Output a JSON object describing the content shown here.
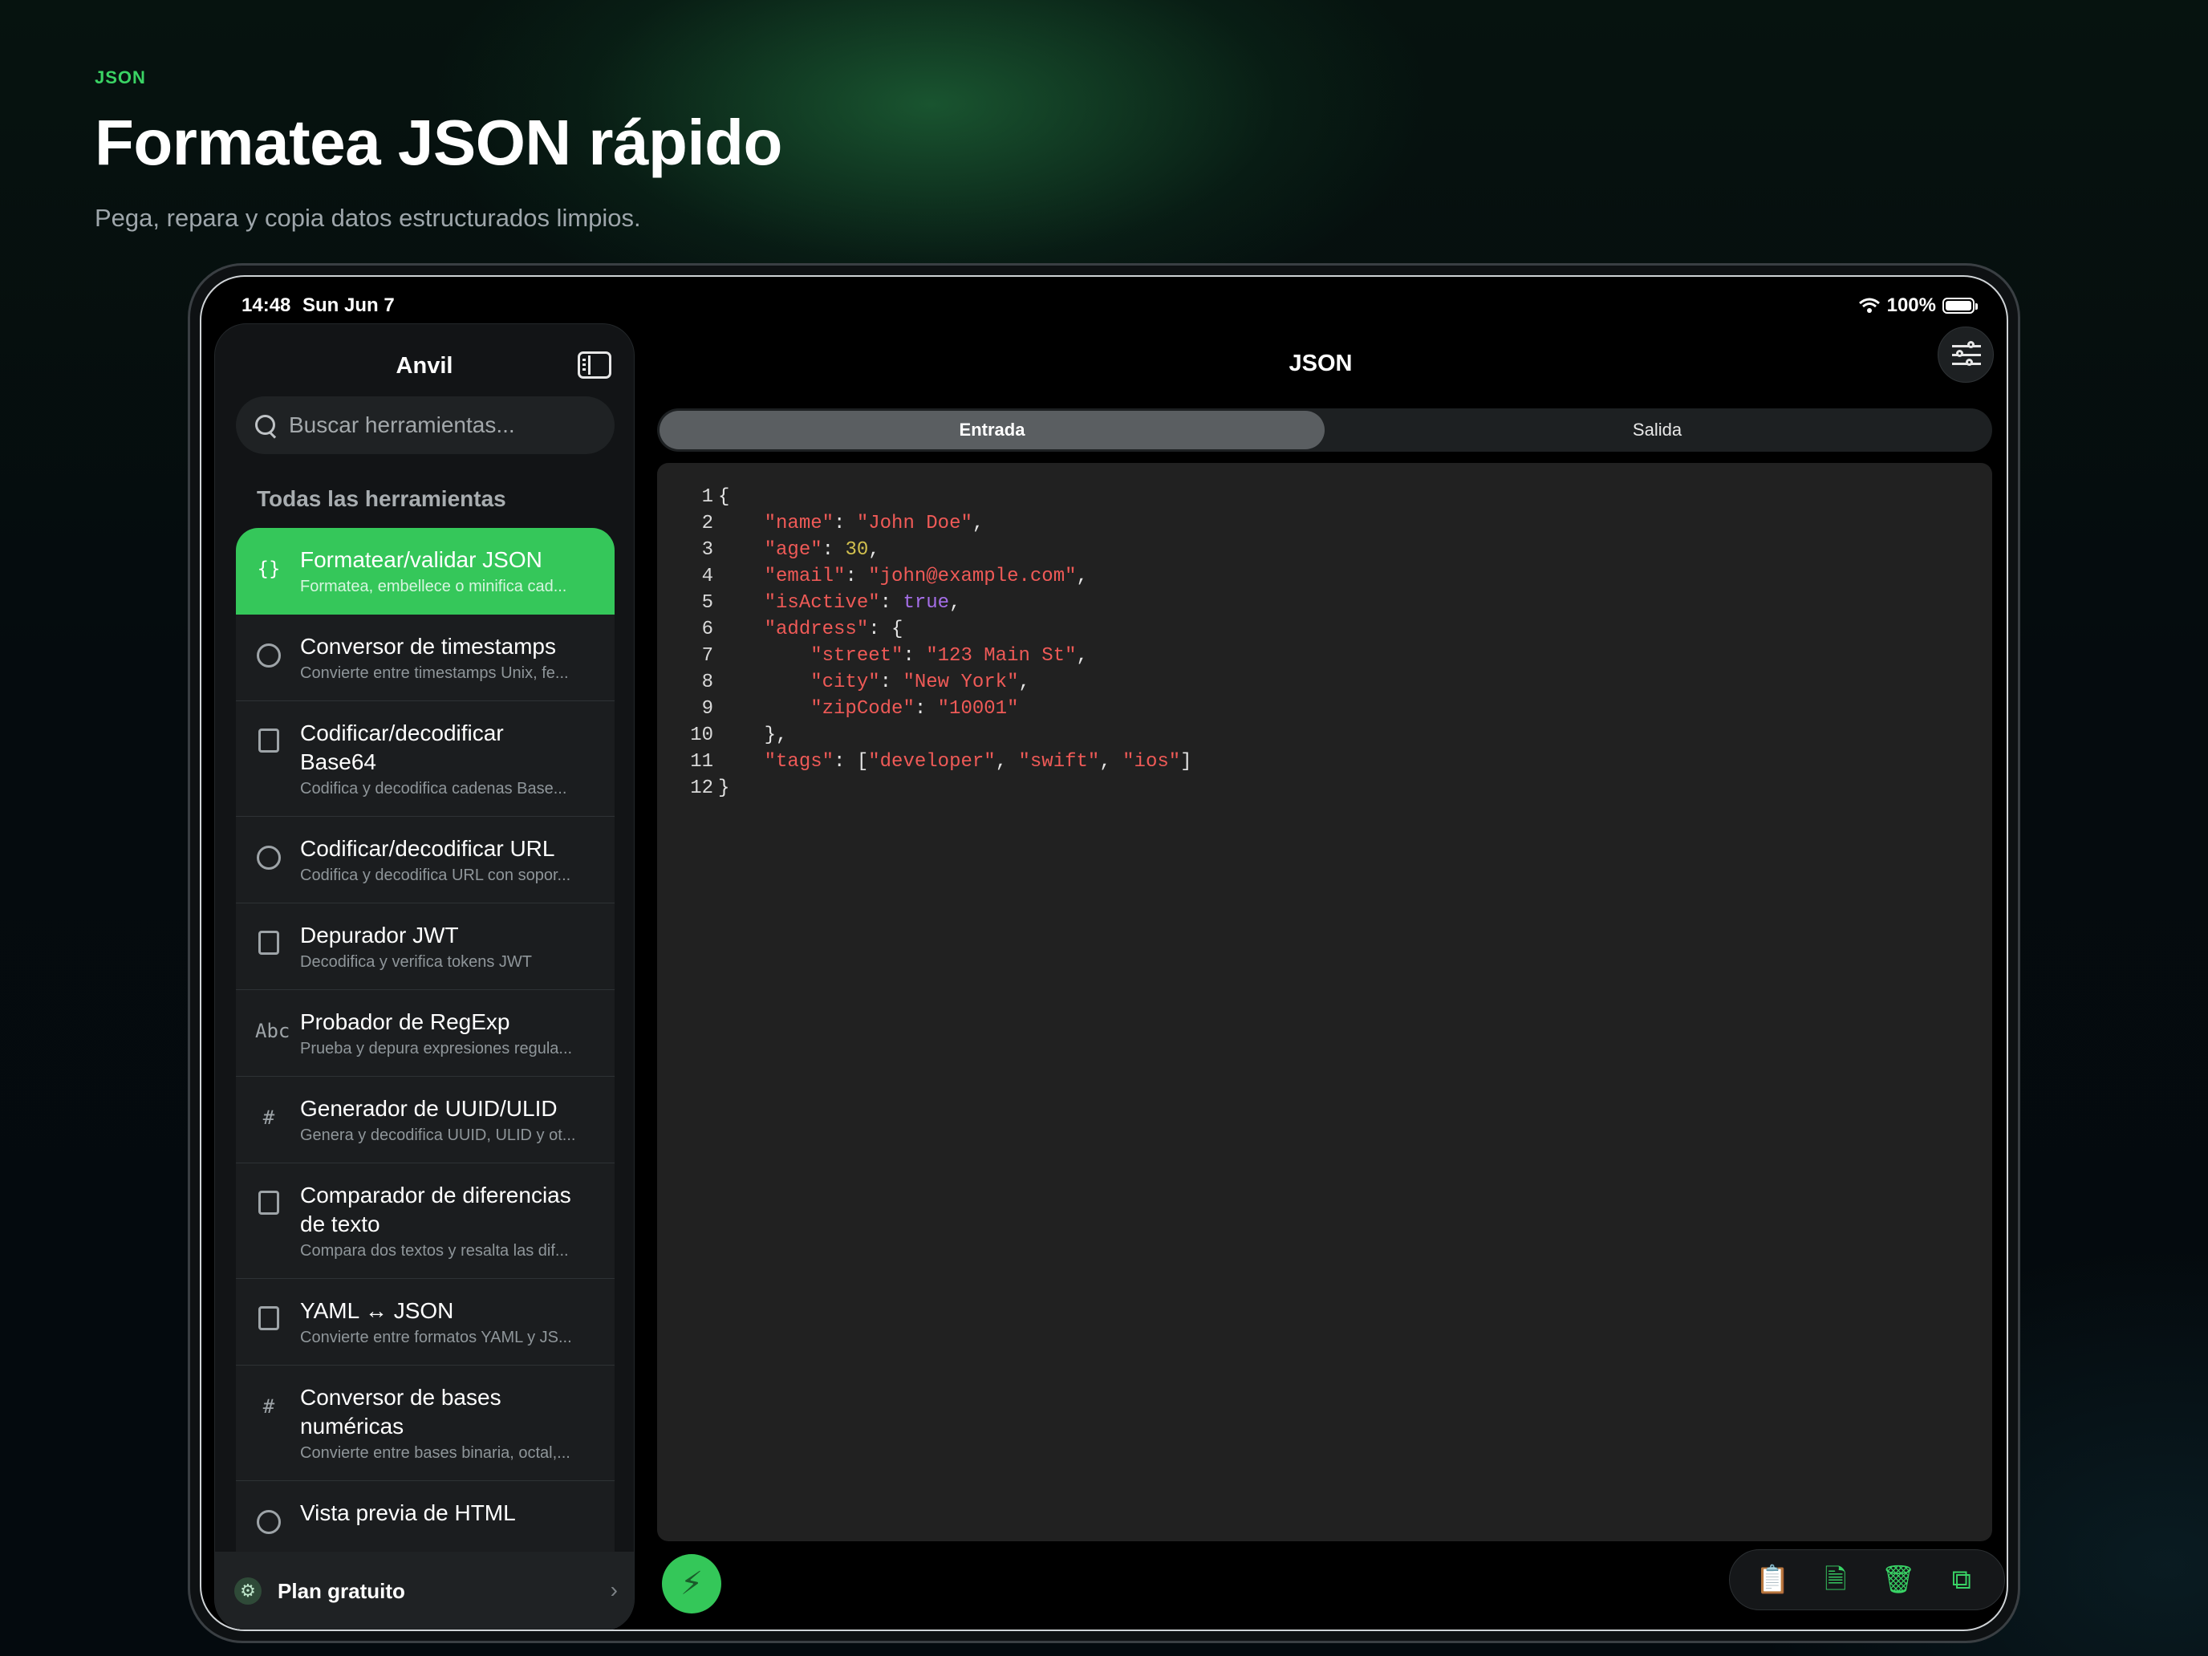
{
  "hero": {
    "eyebrow": "JSON",
    "title": "Formatea JSON rápido",
    "subtitle": "Pega, repara y copia datos estructurados limpios."
  },
  "status_bar": {
    "time": "14:48",
    "date": "Sun Jun 7",
    "battery": "100%"
  },
  "sidebar": {
    "title": "Anvil",
    "search_placeholder": "Buscar herramientas...",
    "section_label": "Todas las herramientas",
    "tools": [
      {
        "name": "Formatear/validar JSON",
        "desc": "Formatea, embellece o minifica cad...",
        "icon": "braces-icon",
        "active": true
      },
      {
        "name": "Conversor de timestamps",
        "desc": "Convierte entre timestamps Unix, fe...",
        "icon": "clock-icon"
      },
      {
        "name": "Codificar/decodificar Base64",
        "desc": "Codifica y decodifica cadenas Base...",
        "icon": "document-search-icon"
      },
      {
        "name": "Codificar/decodificar URL",
        "desc": "Codifica y decodifica URL con sopor...",
        "icon": "link-icon"
      },
      {
        "name": "Depurador JWT",
        "desc": "Decodifica y verifica tokens JWT",
        "icon": "key-frame-icon"
      },
      {
        "name": "Probador de RegExp",
        "desc": "Prueba y depura expresiones regula...",
        "icon": "abc-text-icon",
        "icon_text": "Abc"
      },
      {
        "name": "Generador de UUID/ULID",
        "desc": "Genera y decodifica UUID, ULID y ot...",
        "icon": "hash-icon",
        "icon_text": "#"
      },
      {
        "name": "Comparador de diferencias de texto",
        "desc": "Compara dos textos y resalta las dif...",
        "icon": "diff-document-icon"
      },
      {
        "name": "YAML ↔ JSON",
        "desc": "Convierte entre formatos YAML y JS...",
        "icon": "swap-icon"
      },
      {
        "name": "Conversor de bases numéricas",
        "desc": "Convierte entre bases binaria, octal,...",
        "icon": "number-hash-icon",
        "icon_text": "#"
      },
      {
        "name": "Vista previa de HTML",
        "desc": "",
        "icon": "compass-icon"
      }
    ],
    "plan_label": "Plan gratuito"
  },
  "main": {
    "title": "JSON",
    "tabs": [
      {
        "label": "Entrada",
        "active": true
      },
      {
        "label": "Salida",
        "active": false
      }
    ],
    "line_numbers": [
      "1",
      "2",
      "3",
      "4",
      "5",
      "6",
      "7",
      "8",
      "9",
      "10",
      "11",
      "12"
    ],
    "code_lines": [
      [
        {
          "t": "{",
          "c": "p"
        }
      ],
      [
        {
          "t": "    ",
          "c": "p"
        },
        {
          "t": "\"name\"",
          "c": "k"
        },
        {
          "t": ": ",
          "c": "p"
        },
        {
          "t": "\"John Doe\"",
          "c": "s"
        },
        {
          "t": ",",
          "c": "p"
        }
      ],
      [
        {
          "t": "    ",
          "c": "p"
        },
        {
          "t": "\"age\"",
          "c": "k"
        },
        {
          "t": ": ",
          "c": "p"
        },
        {
          "t": "30",
          "c": "n"
        },
        {
          "t": ",",
          "c": "p"
        }
      ],
      [
        {
          "t": "    ",
          "c": "p"
        },
        {
          "t": "\"email\"",
          "c": "k"
        },
        {
          "t": ": ",
          "c": "p"
        },
        {
          "t": "\"john@example.com\"",
          "c": "s"
        },
        {
          "t": ",",
          "c": "p"
        }
      ],
      [
        {
          "t": "    ",
          "c": "p"
        },
        {
          "t": "\"isActive\"",
          "c": "k"
        },
        {
          "t": ": ",
          "c": "p"
        },
        {
          "t": "true",
          "c": "b"
        },
        {
          "t": ",",
          "c": "p"
        }
      ],
      [
        {
          "t": "    ",
          "c": "p"
        },
        {
          "t": "\"address\"",
          "c": "k"
        },
        {
          "t": ": {",
          "c": "p"
        }
      ],
      [
        {
          "t": "        ",
          "c": "p"
        },
        {
          "t": "\"street\"",
          "c": "k"
        },
        {
          "t": ": ",
          "c": "p"
        },
        {
          "t": "\"123 Main St\"",
          "c": "s"
        },
        {
          "t": ",",
          "c": "p"
        }
      ],
      [
        {
          "t": "        ",
          "c": "p"
        },
        {
          "t": "\"city\"",
          "c": "k"
        },
        {
          "t": ": ",
          "c": "p"
        },
        {
          "t": "\"New York\"",
          "c": "s"
        },
        {
          "t": ",",
          "c": "p"
        }
      ],
      [
        {
          "t": "        ",
          "c": "p"
        },
        {
          "t": "\"zipCode\"",
          "c": "k"
        },
        {
          "t": ": ",
          "c": "p"
        },
        {
          "t": "\"10001\"",
          "c": "s"
        }
      ],
      [
        {
          "t": "    },",
          "c": "p"
        }
      ],
      [
        {
          "t": "    ",
          "c": "p"
        },
        {
          "t": "\"tags\"",
          "c": "k"
        },
        {
          "t": ": [",
          "c": "p"
        },
        {
          "t": "\"developer\"",
          "c": "s"
        },
        {
          "t": ", ",
          "c": "p"
        },
        {
          "t": "\"swift\"",
          "c": "s"
        },
        {
          "t": ", ",
          "c": "p"
        },
        {
          "t": "\"ios\"",
          "c": "s"
        },
        {
          "t": "]",
          "c": "p"
        }
      ],
      [
        {
          "t": "}",
          "c": "p"
        }
      ]
    ],
    "actions": [
      {
        "name": "paste-clipboard-icon",
        "glyph": "📋"
      },
      {
        "name": "document-icon",
        "glyph": "🗎"
      },
      {
        "name": "trash-icon",
        "glyph": "🗑"
      },
      {
        "name": "copy-icon",
        "glyph": "⧉"
      }
    ]
  },
  "colors": {
    "accent": "#34c759",
    "key": "#ef5a57",
    "number": "#d2c04e",
    "boolean": "#a56ee8"
  }
}
